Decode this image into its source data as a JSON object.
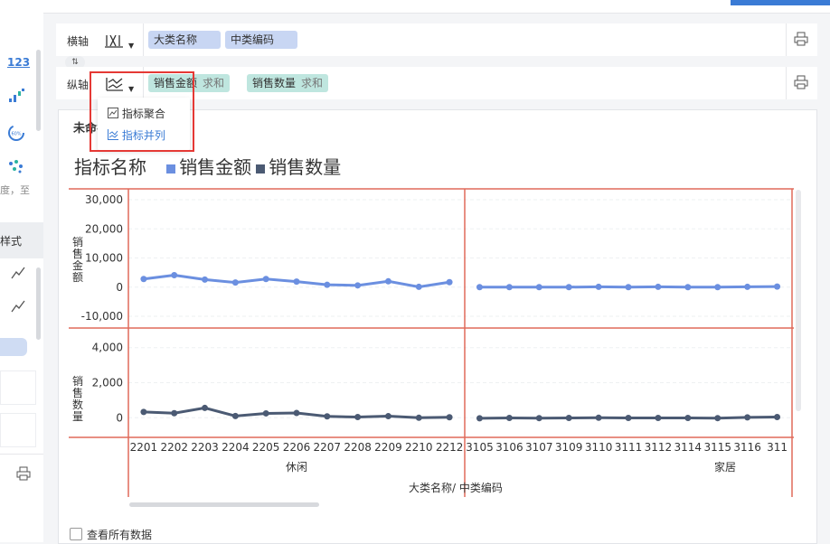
{
  "sidebar": {
    "icons": [
      "numeric-123-icon",
      "bar-chart-icon",
      "gauge-icon",
      "scatter-icon"
    ],
    "gauge_text": "60%",
    "cut_label": "度，至",
    "section_label": "样式",
    "line_icons": [
      "line-chart-icon",
      "line-chart-icon"
    ]
  },
  "xaxis_row": {
    "label": "横轴",
    "type_icon": "table-axis-icon",
    "fields": [
      "大类名称",
      "中类编码"
    ]
  },
  "swap_icon": "swap-icon",
  "yaxis_row": {
    "label": "纵轴",
    "type_icon": "indicator-parallel-icon",
    "fields": [
      {
        "name": "销售金额",
        "agg": "求和"
      },
      {
        "name": "销售数量",
        "agg": "求和"
      }
    ]
  },
  "dropdown": {
    "items": [
      "指标聚合",
      "指标并列"
    ],
    "selected": "指标并列"
  },
  "panel": {
    "title": "未命名",
    "view_all": "查看所有数据"
  },
  "legend": {
    "title": "指标名称",
    "items": [
      {
        "name": "销售金额",
        "color": "#6b8fe0"
      },
      {
        "name": "销售数量",
        "color": "#4b5a73"
      }
    ]
  },
  "chart_data": {
    "type": "line",
    "x_groups": [
      {
        "name": "休闲",
        "categories": [
          "2201",
          "2202",
          "2203",
          "2204",
          "2205",
          "2206",
          "2207",
          "2208",
          "2209",
          "2210",
          "2212"
        ]
      },
      {
        "name": "家居",
        "categories": [
          "3105",
          "3106",
          "3107",
          "3109",
          "3110",
          "3111",
          "3112",
          "3114",
          "3115",
          "3116",
          "311"
        ]
      }
    ],
    "xlabel": "大类名称/ 中类编码",
    "series": [
      {
        "name": "销售金额",
        "ylabel": "销售金额",
        "color": "#6b8fe0",
        "yticks": [
          "30,000",
          "20,000",
          "10,000",
          "0",
          "-10,000"
        ],
        "ylim": [
          -10000,
          30000
        ],
        "values": [
          2800,
          4100,
          2600,
          1600,
          2800,
          1900,
          800,
          600,
          2000,
          100,
          1700,
          0,
          0,
          0,
          0,
          100,
          0,
          100,
          0,
          0,
          100,
          200
        ]
      },
      {
        "name": "销售数量",
        "ylabel": "销售数量",
        "color": "#4b5a73",
        "yticks": [
          "4,000",
          "2,000",
          "0"
        ],
        "ylim": [
          -500,
          4500
        ],
        "values": [
          330,
          260,
          560,
          100,
          250,
          270,
          80,
          40,
          90,
          0,
          30,
          -30,
          -10,
          -20,
          -10,
          0,
          -10,
          -10,
          -10,
          -20,
          20,
          40
        ]
      }
    ]
  }
}
